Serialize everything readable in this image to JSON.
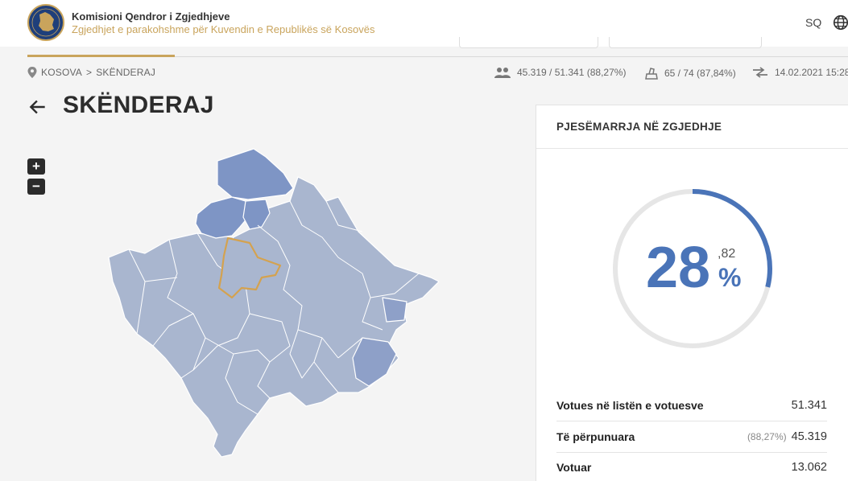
{
  "header": {
    "org_name": "Komisioni Qendror i Zgjedhjeve",
    "subtitle": "Zgjedhjet e parakohshme për Kuvendin e Republikës së Kosovës",
    "language": "SQ"
  },
  "breadcrumb": {
    "root": "KOSOVA",
    "separator": ">",
    "current": "SKËNDERAJ"
  },
  "stats": {
    "voters": "45.319 / 51.341 (88,27%)",
    "stations": "65 / 74 (87,84%)",
    "updated": "14.02.2021 15:28"
  },
  "page": {
    "title": "SKËNDERAJ"
  },
  "zoom": {
    "in": "+",
    "out": "−"
  },
  "panel": {
    "title": "PJESËMARRJA NË ZGJEDHJE",
    "participation": {
      "integer": "28",
      "decimal": ",82",
      "sign": "%",
      "fraction": 0.2882
    },
    "rows": [
      {
        "label": "Votues në listën e votuesve",
        "muted": "",
        "value": "51.341"
      },
      {
        "label": "Të përpunuara",
        "muted": "(88,27%)",
        "value": "45.319"
      },
      {
        "label": "Votuar",
        "muted": "",
        "value": "13.062"
      }
    ]
  },
  "colors": {
    "accent_gold": "#c9a45c",
    "primary_blue": "#4a74b8",
    "map_fill": "#a9b6cf",
    "map_highlight": "#7e95c5"
  }
}
